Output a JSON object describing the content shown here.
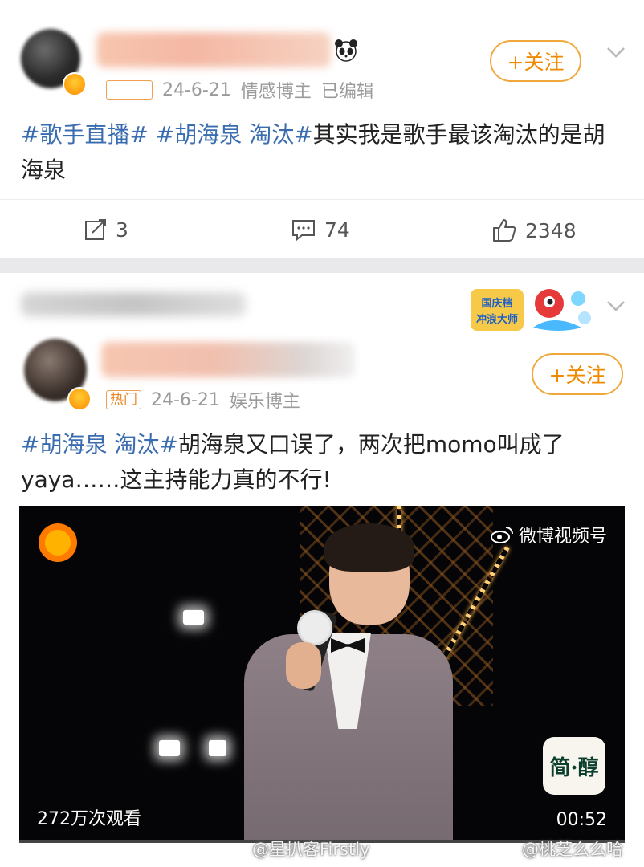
{
  "post1": {
    "hot_tag": "",
    "date": "24-6-21",
    "role": "情感博主",
    "edited": "已编辑",
    "follow_label": "+关注",
    "text_topics": [
      "#歌手直播#",
      "#胡海泉 淘汰#"
    ],
    "text_body": "其实我是歌手最该淘汰的是胡海泉",
    "share_count": "3",
    "comment_count": "74",
    "like_count": "2348"
  },
  "post2": {
    "hot_tag": "热门",
    "date": "24-6-21",
    "role": "娱乐博主",
    "follow_label": "+关注",
    "activity_badge": "国庆档冲浪大师",
    "text_topics": [
      "#胡海泉 淘汰#"
    ],
    "text_body": "胡海泉又口误了，两次把momo叫成了yaya……这主持能力真的不行!",
    "video": {
      "source": "微博视频号",
      "views": "272万次观看",
      "duration": "00:52",
      "brand": "简·醇"
    }
  },
  "watermarks": [
    "@星扒客Firstly",
    "@桃芝么么哈"
  ],
  "colors": {
    "accent_orange": "#f08a00",
    "topic_blue": "#3a6cb0",
    "background": "#e9e9ec"
  }
}
